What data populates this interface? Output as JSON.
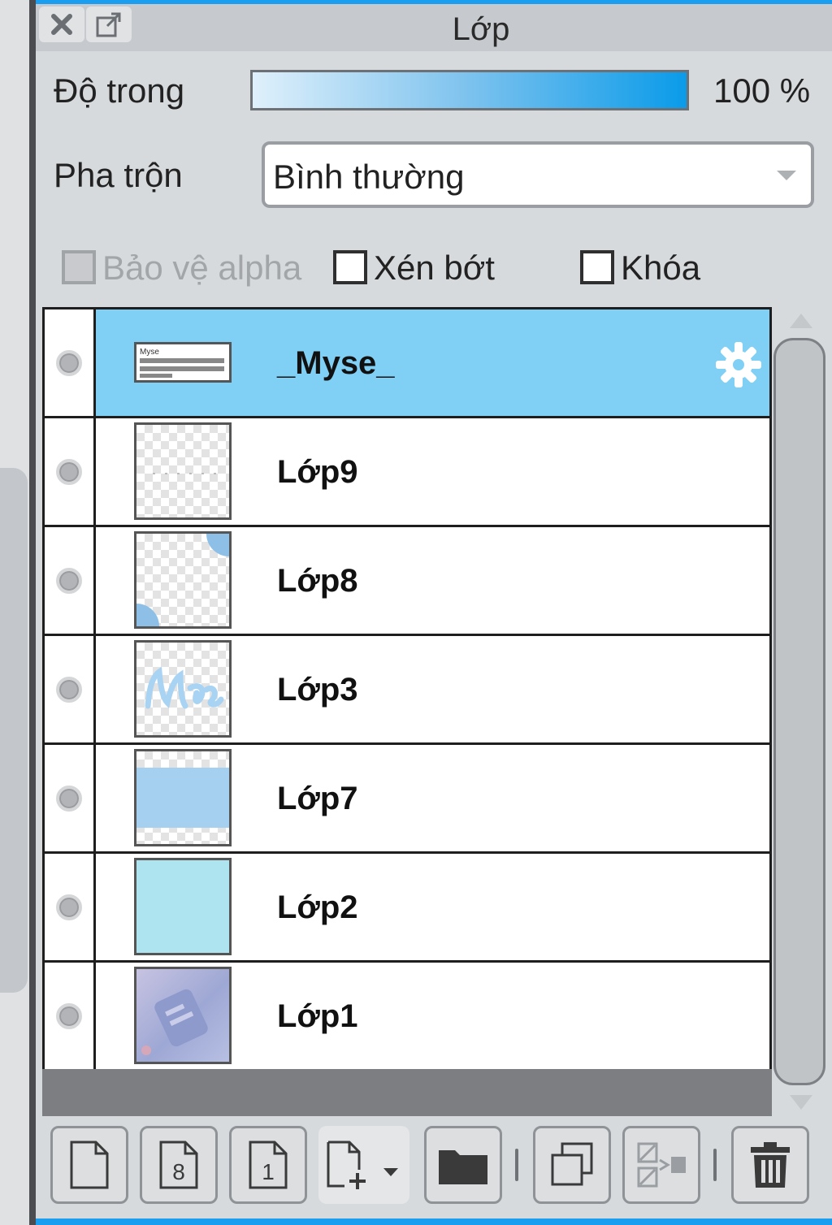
{
  "panel": {
    "title": "Lớp"
  },
  "opacity": {
    "label": "Độ trong",
    "value": "100 %",
    "percent": 100
  },
  "blend": {
    "label": "Pha trộn",
    "value": "Bình thường"
  },
  "options": {
    "protect_alpha": "Bảo vệ alpha",
    "clip": "Xén bớt",
    "lock": "Khóa"
  },
  "layers": [
    {
      "name": "_Myse_",
      "selected": true
    },
    {
      "name": "Lớp9"
    },
    {
      "name": "Lớp8"
    },
    {
      "name": "Lớp3"
    },
    {
      "name": "Lớp7"
    },
    {
      "name": "Lớp2"
    },
    {
      "name": "Lớp1"
    }
  ],
  "thumb_text": "Myse",
  "toolbar_icons": {
    "new_digit_8": "8",
    "new_digit_1": "1"
  },
  "colors": {
    "accent": "#1a9ff0",
    "selected_row": "#80cff5",
    "panel_bg": "#d7dadd"
  }
}
